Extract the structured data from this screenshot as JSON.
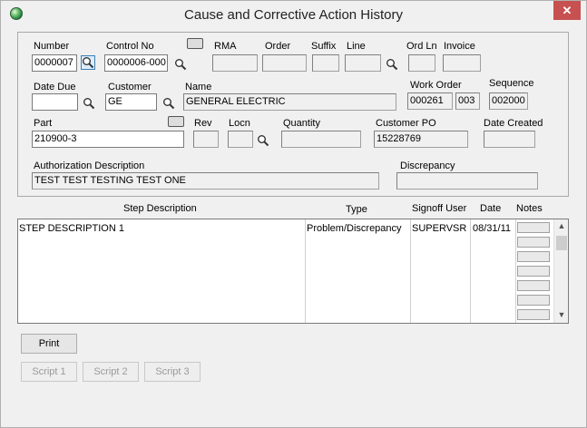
{
  "window": {
    "title": "Cause and Corrective Action History",
    "close_label": "✕"
  },
  "form": {
    "labels": {
      "number": "Number",
      "control_no": "Control No",
      "rma": "RMA",
      "order": "Order",
      "suffix": "Suffix",
      "line": "Line",
      "ord_ln": "Ord Ln",
      "invoice": "Invoice",
      "date_due": "Date Due",
      "customer": "Customer",
      "name": "Name",
      "work_order": "Work Order",
      "sequence": "Sequence",
      "part": "Part",
      "rev": "Rev",
      "locn": "Locn",
      "quantity": "Quantity",
      "customer_po": "Customer PO",
      "date_created": "Date Created",
      "auth_desc": "Authorization Description",
      "discrepancy": "Discrepancy"
    },
    "values": {
      "number": "0000007",
      "control_no": "0000006-000",
      "rma": "",
      "order": "",
      "suffix": "",
      "line": "",
      "ord_ln": "",
      "invoice": "",
      "date_due": "",
      "customer": "GE",
      "name": "GENERAL ELECTRIC",
      "work_order": "000261",
      "work_order_seq": "003",
      "sequence": "002000",
      "part": "210900-3",
      "rev": "",
      "locn": "",
      "quantity": "",
      "customer_po": "15228769",
      "date_created": "",
      "auth_desc": "TEST TEST TESTING TEST ONE",
      "discrepancy": ""
    }
  },
  "steps": {
    "headers": {
      "step_description": "Step Description",
      "type": "Type",
      "signoff_user": "Signoff User",
      "date": "Date",
      "notes": "Notes"
    },
    "rows": [
      {
        "description": "STEP DESCRIPTION 1",
        "type": "Problem/Discrepancy",
        "signoff_user": "SUPERVSR",
        "date": "08/31/11"
      }
    ]
  },
  "buttons": {
    "print": "Print",
    "script1": "Script 1",
    "script2": "Script 2",
    "script3": "Script 3"
  },
  "icons": {
    "lookup": "magnifier-icon",
    "card": "card-icon"
  }
}
